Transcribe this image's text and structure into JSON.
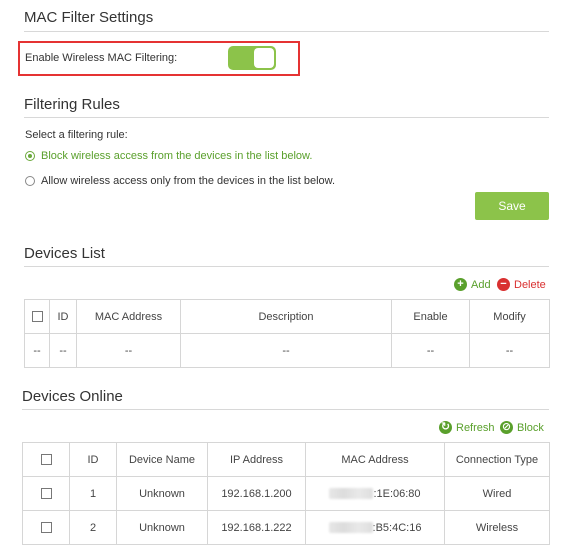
{
  "mac_filter": {
    "title": "MAC Filter Settings",
    "enable_label": "Enable Wireless MAC Filtering:",
    "enabled": true
  },
  "rules": {
    "title": "Filtering Rules",
    "prompt": "Select a filtering rule:",
    "option_block": "Block wireless access from the devices in the list below.",
    "option_allow": "Allow wireless access only from the devices in the list below.",
    "selected": "block",
    "save_label": "Save"
  },
  "devices_list": {
    "title": "Devices List",
    "add_label": "Add",
    "delete_label": "Delete",
    "headers": [
      "ID",
      "MAC Address",
      "Description",
      "Enable",
      "Modify"
    ],
    "empty_row": [
      "--",
      "--",
      "--",
      "--",
      "--",
      "--"
    ]
  },
  "devices_online": {
    "title": "Devices Online",
    "refresh_label": "Refresh",
    "block_label": "Block",
    "headers": [
      "ID",
      "Device Name",
      "IP Address",
      "MAC Address",
      "Connection Type"
    ],
    "rows": [
      {
        "id": "1",
        "name": "Unknown",
        "ip": "192.168.1.200",
        "mac_suffix": ":1E:06:80",
        "type": "Wired"
      },
      {
        "id": "2",
        "name": "Unknown",
        "ip": "192.168.1.222",
        "mac_suffix": ":B5:4C:16",
        "type": "Wireless"
      }
    ]
  },
  "colors": {
    "accent_green": "#8cc34a",
    "highlight_red": "#e53333",
    "delete_red": "#d93030"
  }
}
